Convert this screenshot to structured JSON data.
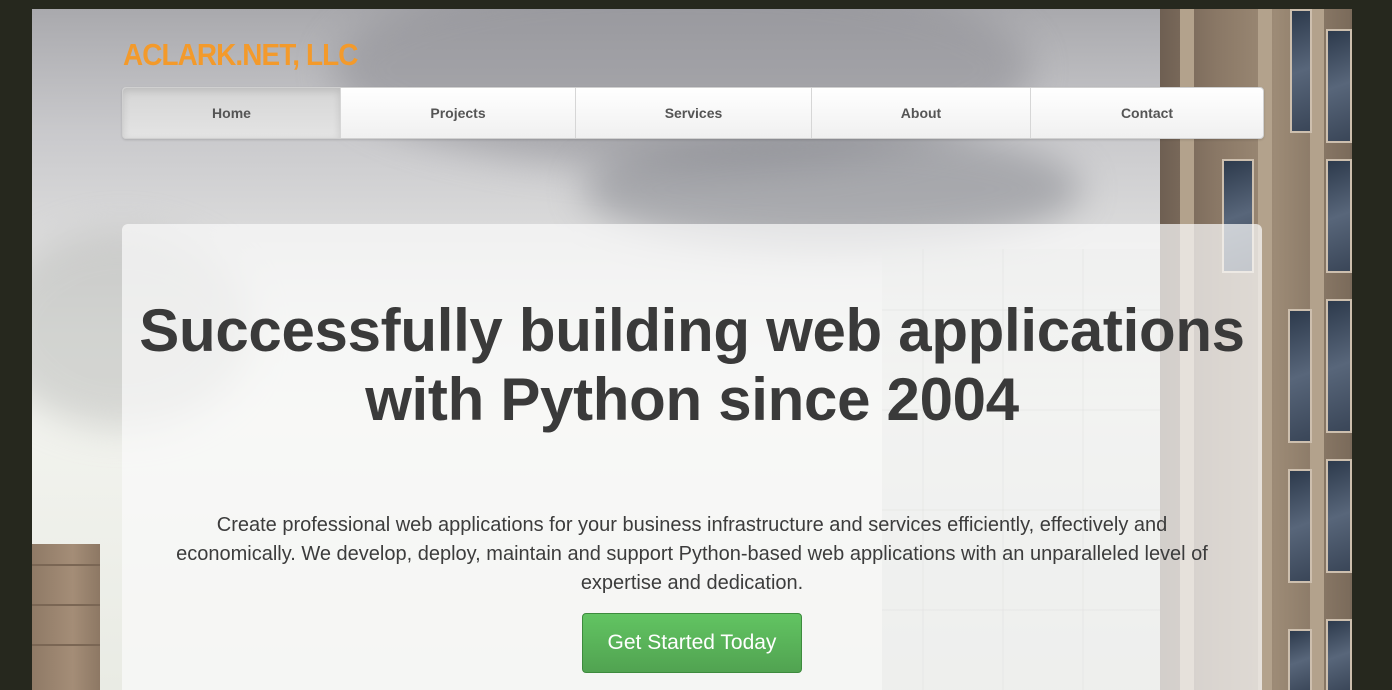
{
  "brand": {
    "logo_text": "ACLARK.NET, LLC",
    "logo_color": "#f39a2b"
  },
  "nav": {
    "items": [
      {
        "label": "Home",
        "active": true
      },
      {
        "label": "Projects",
        "active": false
      },
      {
        "label": "Services",
        "active": false
      },
      {
        "label": "About",
        "active": false
      },
      {
        "label": "Contact",
        "active": false
      }
    ]
  },
  "hero": {
    "headline": "Successfully building web applications with Python since 2004",
    "lead": "Create professional web applications for your business infrastructure and services efficiently, effectively and economically. We develop, deploy, maintain and support Python-based web applications with an unparalleled level of expertise and dedication.",
    "cta_label": "Get Started Today",
    "cta_color": "#5cb85c"
  }
}
